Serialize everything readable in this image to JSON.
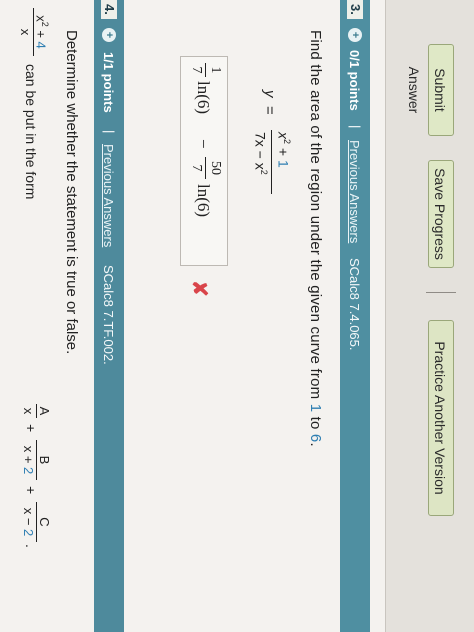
{
  "toolbar": {
    "submit_label": "Submit Answer",
    "save_label": "Save Progress",
    "practice_label": "Practice Another Version"
  },
  "q3": {
    "number": "3.",
    "points": "0/1 points",
    "separator": "|",
    "previous": "Previous Answers",
    "code": "SCalc8 7.4.065.",
    "prompt_start": "Find the area of the region under the given curve from ",
    "from": "1",
    "to_word": " to ",
    "to": "6",
    "prompt_end": ".",
    "eq_lhs": "y",
    "eq_equals": "=",
    "eq_num": "x",
    "eq_num_exp": "2",
    "eq_num_plus": " + ",
    "eq_num_const": "1",
    "eq_den": "7x − x",
    "eq_den_exp": "2",
    "answer": {
      "f1_num": "1",
      "f1_den": "7",
      "ln1": "ln(6)",
      "minus": "−",
      "f2_num": "50",
      "f2_den": "7",
      "ln2": "ln(6)"
    },
    "status": "✘"
  },
  "q4": {
    "number": "4.",
    "points": "1/1 points",
    "separator": "|",
    "previous": "Previous Answers",
    "code": "SCalc8 7.TF.002.",
    "prompt": "Determine whether the statement is true or false.",
    "stmt_num_x": "x",
    "stmt_num_exp": "2",
    "stmt_num_plus": " + ",
    "stmt_num_const": "4",
    "stmt_den": "x",
    "stmt_text": "can be put in the form",
    "fa_num": "A",
    "fa_den": "x",
    "plus1": "+",
    "fb_num": "B",
    "fb_den_x": "x + ",
    "fb_den_c": "2",
    "plus2": "+",
    "fc_num": "C",
    "fc_den_x": "x − ",
    "fc_den_c": "2",
    "end": "."
  },
  "colors": {
    "band": "#4f8fa1",
    "highlight": "#2f7fb2",
    "wrong": "#d9454a",
    "button": "#dfe8c6"
  }
}
